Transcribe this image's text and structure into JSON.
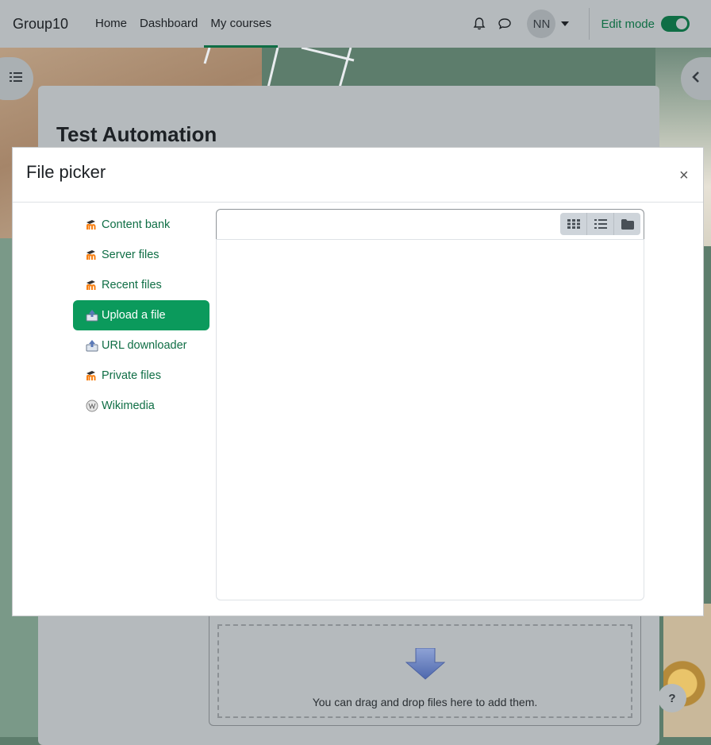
{
  "navbar": {
    "brand": "Group10",
    "links": [
      "Home",
      "Dashboard",
      "My courses"
    ],
    "active_link": "My courses",
    "avatar_initials": "NN",
    "edit_mode_label": "Edit mode",
    "edit_mode_on": true
  },
  "page": {
    "course_title": "Test Automation",
    "drop_text": "You can drag and drop files here to add them.",
    "help_label": "?"
  },
  "modal": {
    "title": "File picker",
    "close_symbol": "×",
    "repositories": [
      {
        "label": "Content bank",
        "icon": "moodle-icon"
      },
      {
        "label": "Server files",
        "icon": "moodle-icon"
      },
      {
        "label": "Recent files",
        "icon": "moodle-icon"
      },
      {
        "label": "Upload a file",
        "icon": "upload-icon",
        "active": true
      },
      {
        "label": "URL downloader",
        "icon": "url-download-icon"
      },
      {
        "label": "Private files",
        "icon": "moodle-icon"
      },
      {
        "label": "Wikimedia",
        "icon": "wikimedia-icon"
      }
    ],
    "view_buttons": [
      "grid-view-icon",
      "list-view-icon",
      "folder-view-icon"
    ]
  },
  "colors": {
    "accent": "#0f6e45",
    "active_item_bg": "#0b9a5c",
    "navbar_bg": "#b5babd"
  }
}
